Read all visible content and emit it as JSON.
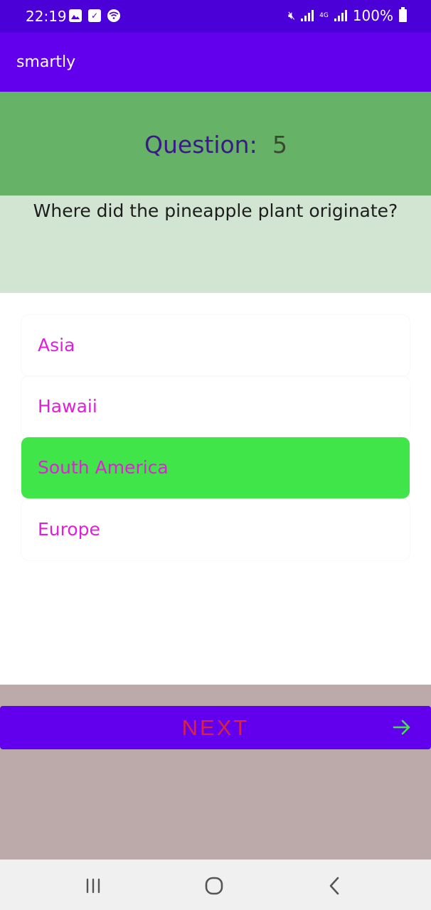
{
  "status_bar": {
    "time": "22:19",
    "battery": "100%",
    "network": "4G",
    "icons": [
      "gallery-icon",
      "check-icon",
      "wifi-icon",
      "mute-icon",
      "signal-icon",
      "battery-icon"
    ]
  },
  "app_bar": {
    "title": "smartly"
  },
  "question": {
    "label": "Question:",
    "number": "5",
    "text": "Where did the pineapple plant originate?"
  },
  "options": [
    {
      "label": "Asia",
      "selected": false
    },
    {
      "label": "Hawaii",
      "selected": false
    },
    {
      "label": "South America",
      "selected": true
    },
    {
      "label": "Europe",
      "selected": false
    }
  ],
  "next_button": {
    "label": "NEXT",
    "icon": "arrow-right-icon"
  },
  "nav_bar": {
    "icons": [
      "recent-apps-icon",
      "home-icon",
      "back-icon"
    ]
  },
  "colors": {
    "status_bar": "#4a00d6",
    "app_bar": "#6200ee",
    "question_header": "#66b266",
    "question_panel": "#d2e5d2",
    "option_text": "#e020d8",
    "selected_option": "#40e54a",
    "bottom_area": "#bca9a9",
    "next_label": "#d8243e",
    "next_arrow": "#40e54a"
  }
}
